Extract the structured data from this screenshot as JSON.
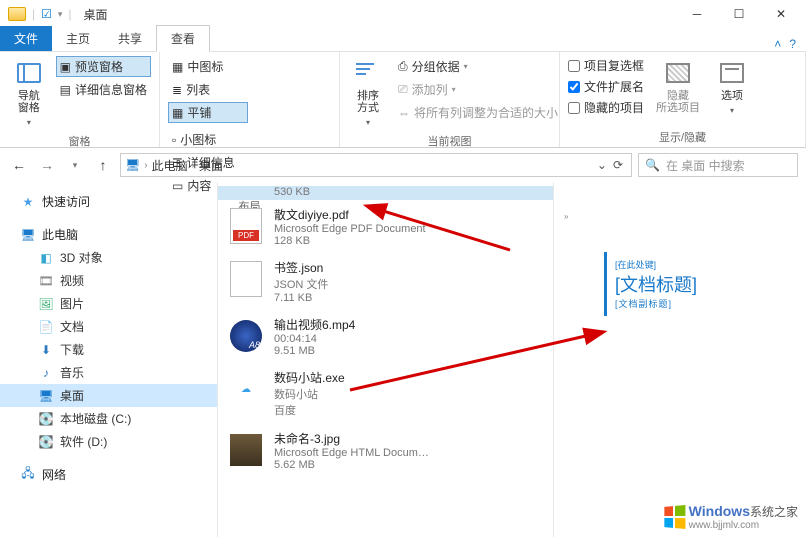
{
  "window": {
    "title": "桌面"
  },
  "tabs": {
    "file": "文件",
    "home": "主页",
    "share": "共享",
    "view": "查看"
  },
  "ribbon": {
    "panes": {
      "nav": "导航窗格",
      "preview": "预览窗格",
      "details": "详细信息窗格",
      "group": "窗格"
    },
    "layout": {
      "medium_icons": "中图标",
      "small_icons": "小图标",
      "list": "列表",
      "details": "详细信息",
      "tiles": "平铺",
      "content": "内容",
      "group": "布局"
    },
    "view": {
      "sort": "排序方式",
      "groupby": "分组依据",
      "addcols": "添加列",
      "autofit": "将所有列调整为合适的大小",
      "group": "当前视图"
    },
    "show": {
      "checkboxes": "项目复选框",
      "extensions": "文件扩展名",
      "hidden": "隐藏的项目",
      "hide_btn": "隐藏\n所选项目",
      "options": "选项",
      "group": "显示/隐藏"
    }
  },
  "address": {
    "thispc": "此电脑",
    "desktop": "桌面",
    "search_placeholder": "在 桌面 中搜索"
  },
  "nav": {
    "quick": "快速访问",
    "thispc": "此电脑",
    "objects3d": "3D 对象",
    "videos": "视频",
    "pictures": "图片",
    "documents": "文档",
    "downloads": "下载",
    "music": "音乐",
    "desktop": "桌面",
    "localc": "本地磁盘 (C:)",
    "softd": "软件 (D:)",
    "network": "网络"
  },
  "files": [
    {
      "name": "",
      "type": "",
      "size": "530 KB",
      "selected": true,
      "truncated": true
    },
    {
      "name": "散文diyiye.pdf",
      "type": "Microsoft Edge PDF Document",
      "size": "128 KB",
      "icon": "pdf"
    },
    {
      "name": "书签.json",
      "type": "JSON 文件",
      "size": "7.11 KB",
      "icon": "json"
    },
    {
      "name": "输出视频6.mp4",
      "type": "00:04:14",
      "size": "9.51 MB",
      "icon": "mp4"
    },
    {
      "name": "数码小站.exe",
      "type": "数码小站",
      "size": "百度",
      "icon": "exe"
    },
    {
      "name": "未命名-3.jpg",
      "type": "Microsoft Edge HTML Docum…",
      "size": "5.62 MB",
      "icon": "jpg"
    }
  ],
  "preview": {
    "sup": "[在此处键]",
    "title": "[文档标题]",
    "sub": "[文档副标题]"
  },
  "watermark": {
    "brand1": "Windows",
    "brand2": "系统之家",
    "url": "www.bjjmlv.com"
  }
}
